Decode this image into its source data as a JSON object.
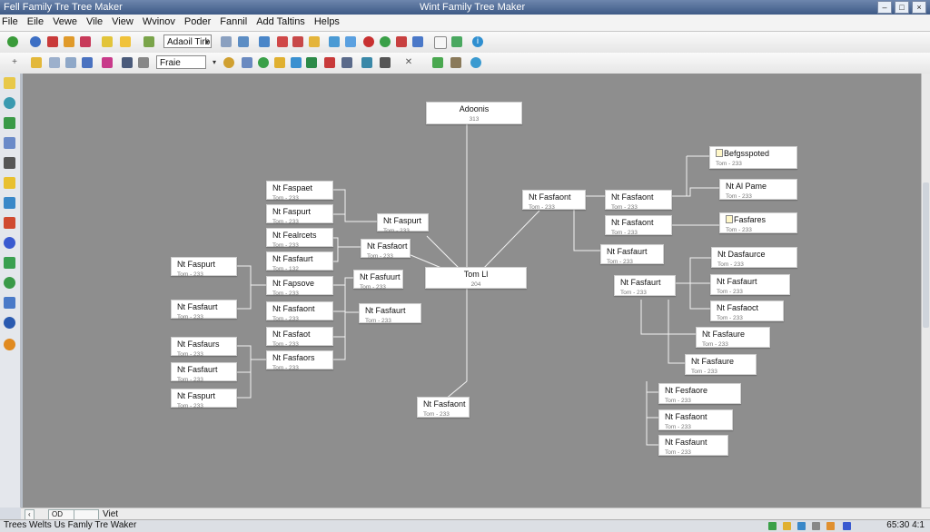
{
  "window": {
    "title_left": "Fell Family Tre Tree Maker",
    "title_center": "Wint Family Tree Maker"
  },
  "menu": [
    "File",
    "Eile",
    "Vewe",
    "Vile",
    "View",
    "Wvinov",
    "Poder",
    "Fannil",
    "Add Taltins",
    "Helps"
  ],
  "toolbar": {
    "font_select": "Adaoil Tirb",
    "style_select": "Fraie"
  },
  "tree": {
    "root": {
      "name": "Adoonis",
      "sub": "313"
    },
    "center": {
      "name": "Tom Ll",
      "sub": "204"
    },
    "bottom": {
      "name": "Nt Fasfaont",
      "sub": "Tom - 233"
    },
    "left_col3": [
      {
        "name": "Nt Faspaet",
        "sub": "Tom - 233"
      },
      {
        "name": "Nt Faspurt",
        "sub": "Tom - 233"
      },
      {
        "name": "Nt Fealrcets",
        "sub": "Tom - 233"
      },
      {
        "name": "Nt Fasfaurt",
        "sub": "Tom - 132"
      },
      {
        "name": "Nt Fapsove",
        "sub": "Tom - 233"
      },
      {
        "name": "Nt Fasfaont",
        "sub": "Tom - 233"
      },
      {
        "name": "Nt Fasfaot",
        "sub": "Tom - 233"
      },
      {
        "name": "Nt Fasfaors",
        "sub": "Tom - 233"
      }
    ],
    "left_col4": [
      {
        "name": "Nt Faspurt",
        "sub": "Tom - 233"
      },
      {
        "name": "Nt Fasfaort",
        "sub": "Tom - 233"
      },
      {
        "name": "Nt Fasfuurt",
        "sub": "Tom - 233"
      },
      {
        "name": "Nt Fasfaurt",
        "sub": "Tom - 233"
      }
    ],
    "left_col1": [
      {
        "name": "Nt Faspurt",
        "sub": "Tom - 233"
      },
      {
        "name": "Nt Fasfaurt",
        "sub": "Tom - 233"
      },
      {
        "name": "Nt Fasfaurs",
        "sub": "Tom - 233"
      },
      {
        "name": "Nt Fasfaurt",
        "sub": "Tom - 233"
      },
      {
        "name": "Nt Faspurt",
        "sub": "Tom - 233"
      }
    ],
    "right": [
      {
        "name": "Nt Fasfaont",
        "sub": "Tom - 233"
      },
      {
        "name": "Nt Fasfaont",
        "sub": "Tom - 233"
      },
      {
        "name": "Nt Fasfaont",
        "sub": "Tom - 233"
      },
      {
        "name": "Nt Fasfaurt",
        "sub": "Tom - 233"
      },
      {
        "name": "Nt Fasfaurt",
        "sub": "Tom - 233"
      },
      {
        "name": "Befgsspoted",
        "sub": "Tom - 233"
      },
      {
        "name": "Nt Al Pame",
        "sub": "Tom - 233"
      },
      {
        "name": "Fasfares",
        "sub": "Tom - 233"
      },
      {
        "name": "Nt Dasfaurce",
        "sub": "Tom - 233"
      },
      {
        "name": "Nt Fasfaurt",
        "sub": "Tom - 233"
      },
      {
        "name": "Nt Fasfaoct",
        "sub": "Tom - 233"
      },
      {
        "name": "Nt Fasfaure",
        "sub": "Tom - 233"
      },
      {
        "name": "Nt Fasfaure",
        "sub": "Tom - 233"
      },
      {
        "name": "Nt Fesfaore",
        "sub": "Tom - 233"
      },
      {
        "name": "Nt Fasfaont",
        "sub": "Tom - 233"
      },
      {
        "name": "Nt Fasfaunt",
        "sub": "Tom - 233"
      }
    ]
  },
  "hscroll": {
    "tab1": "OD",
    "tab2": "",
    "label": "Viet"
  },
  "status": {
    "text": "Trees Welts Us Famly Tre Waker",
    "clock": "65:30 4:1"
  }
}
